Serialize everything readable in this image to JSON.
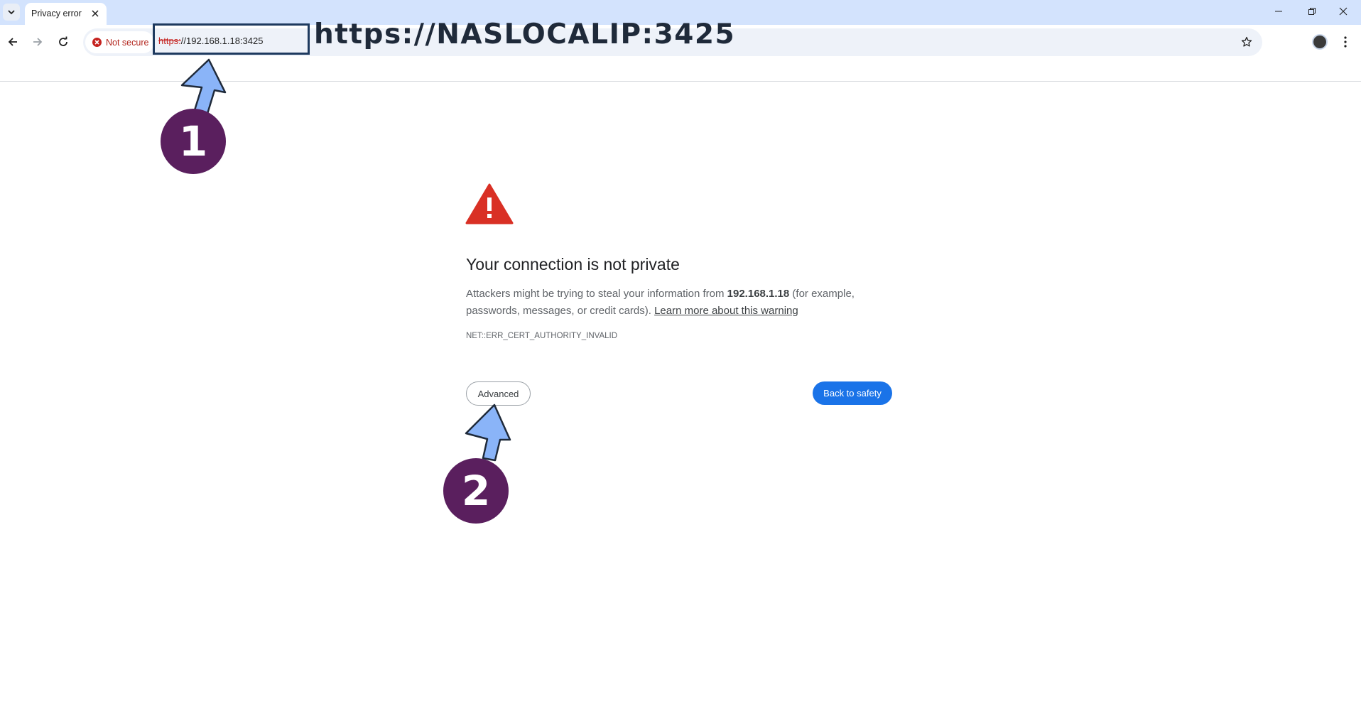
{
  "browser": {
    "tab_title": "Privacy error",
    "security_chip": "Not secure",
    "url_scheme": "https:",
    "url_rest": "//192.168.1.18:3425",
    "overlay_url": "https://NASLOCALIP:3425"
  },
  "page": {
    "heading": "Your connection is not private",
    "desc_prefix": "Attackers might be trying to steal your information from ",
    "desc_host": "192.168.1.18",
    "desc_suffix": " (for example, passwords, messages, or credit cards). ",
    "learn_more": "Learn more about this warning",
    "error_code": "NET::ERR_CERT_AUTHORITY_INVALID",
    "advanced_button": "Advanced",
    "back_button": "Back to safety"
  },
  "annotations": {
    "step1": "1",
    "step2": "2",
    "badge_color": "#5a1f5e",
    "arrow_color": "#8ab4f8"
  },
  "colors": {
    "accent": "#1a73e8",
    "warning": "#d93025",
    "tabstrip": "#d3e3fd"
  }
}
